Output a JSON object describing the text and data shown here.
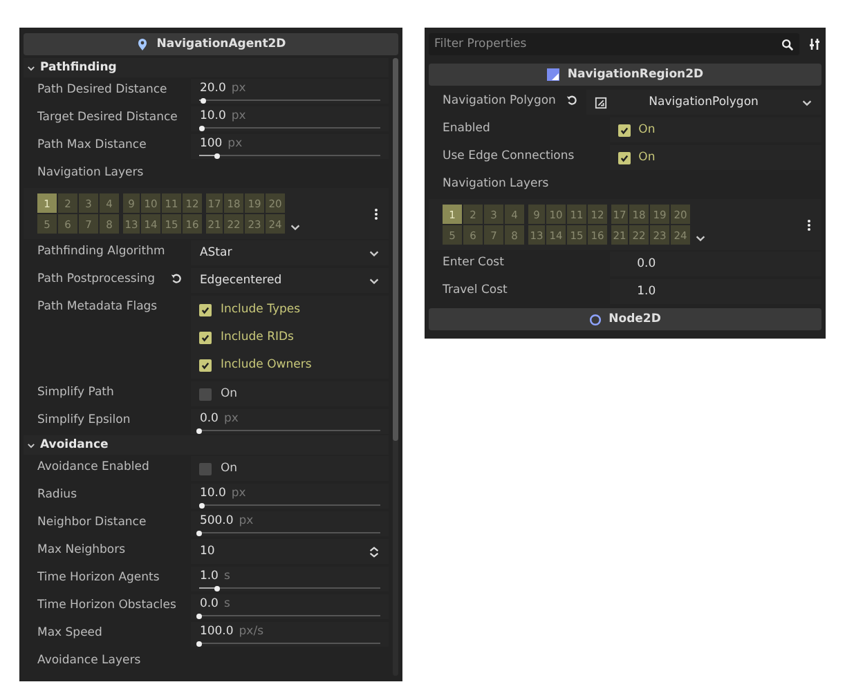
{
  "agent_panel": {
    "title": "NavigationAgent2D",
    "sections": [
      {
        "title": "Pathfinding",
        "expanded": true,
        "rows": [
          {
            "kind": "slider",
            "label": "Path Desired Distance",
            "value": "20.0",
            "unit": "px",
            "level": 0.02
          },
          {
            "kind": "slider",
            "label": "Target Desired Distance",
            "value": "10.0",
            "unit": "px",
            "level": 0.01
          },
          {
            "kind": "slider",
            "label": "Path Max Distance",
            "value": "100",
            "unit": "px",
            "level": 0.1
          },
          {
            "kind": "label",
            "label": "Navigation Layers"
          },
          {
            "kind": "layers",
            "layers": [
              {
                "label": "1",
                "selected": true
              },
              {
                "label": "2",
                "selected": false
              },
              {
                "label": "3",
                "selected": false
              },
              {
                "label": "4",
                "selected": false
              },
              {
                "label": "9",
                "selected": false
              },
              {
                "label": "10",
                "selected": false
              },
              {
                "label": "11",
                "selected": false
              },
              {
                "label": "12",
                "selected": false
              },
              {
                "label": "17",
                "selected": false
              },
              {
                "label": "18",
                "selected": false
              },
              {
                "label": "19",
                "selected": false
              },
              {
                "label": "20",
                "selected": false
              },
              {
                "label": "5",
                "selected": false
              },
              {
                "label": "6",
                "selected": false
              },
              {
                "label": "7",
                "selected": false
              },
              {
                "label": "8",
                "selected": false
              },
              {
                "label": "13",
                "selected": false
              },
              {
                "label": "14",
                "selected": false
              },
              {
                "label": "15",
                "selected": false
              },
              {
                "label": "16",
                "selected": false
              },
              {
                "label": "21",
                "selected": false
              },
              {
                "label": "22",
                "selected": false
              },
              {
                "label": "23",
                "selected": false
              },
              {
                "label": "24",
                "selected": false
              }
            ]
          },
          {
            "kind": "dropdown",
            "label": "Pathfinding Algorithm",
            "value": "AStar",
            "reset": false
          },
          {
            "kind": "dropdown",
            "label": "Path Postprocessing",
            "value": "Edgecentered",
            "reset": true
          },
          {
            "kind": "flags",
            "label": "Path Metadata Flags",
            "options": [
              {
                "label": "Include Types",
                "checked": true
              },
              {
                "label": "Include RIDs",
                "checked": true
              },
              {
                "label": "Include Owners",
                "checked": true
              }
            ]
          },
          {
            "kind": "checkbox",
            "label": "Simplify Path",
            "text": "On",
            "checked": false
          },
          {
            "kind": "slider",
            "label": "Simplify Epsilon",
            "value": "0.0",
            "unit": "px",
            "level": 0
          }
        ]
      },
      {
        "title": "Avoidance",
        "expanded": true,
        "rows": [
          {
            "kind": "checkbox",
            "label": "Avoidance Enabled",
            "text": "On",
            "checked": false
          },
          {
            "kind": "slider",
            "label": "Radius",
            "value": "10.0",
            "unit": "px",
            "level": 0.01
          },
          {
            "kind": "slider",
            "label": "Neighbor Distance",
            "value": "500.0",
            "unit": "px",
            "level": 0
          },
          {
            "kind": "spin",
            "label": "Max Neighbors",
            "value": "10"
          },
          {
            "kind": "slider",
            "label": "Time Horizon Agents",
            "value": "1.0",
            "unit": "s",
            "level": 0.1
          },
          {
            "kind": "slider",
            "label": "Time Horizon Obstacles",
            "value": "0.0",
            "unit": "s",
            "level": 0
          },
          {
            "kind": "slider",
            "label": "Max Speed",
            "value": "100.0",
            "unit": "px/s",
            "level": 0
          },
          {
            "kind": "label",
            "label": "Avoidance Layers"
          }
        ]
      }
    ]
  },
  "region_panel": {
    "filter": {
      "placeholder": "Filter Properties"
    },
    "title": "NavigationRegion2D",
    "rows": [
      {
        "kind": "resource",
        "label": "Navigation Polygon",
        "value": "NavigationPolygon",
        "reset": true
      },
      {
        "kind": "checkbox",
        "label": "Enabled",
        "text": "On",
        "checked": true
      },
      {
        "kind": "checkbox",
        "label": "Use Edge Connections",
        "text": "On",
        "checked": true
      },
      {
        "kind": "label",
        "label": "Navigation Layers"
      },
      {
        "kind": "layers",
        "layers": [
          {
            "label": "1",
            "selected": true
          },
          {
            "label": "2",
            "selected": false
          },
          {
            "label": "3",
            "selected": false
          },
          {
            "label": "4",
            "selected": false
          },
          {
            "label": "9",
            "selected": false
          },
          {
            "label": "10",
            "selected": false
          },
          {
            "label": "11",
            "selected": false
          },
          {
            "label": "12",
            "selected": false
          },
          {
            "label": "17",
            "selected": false
          },
          {
            "label": "18",
            "selected": false
          },
          {
            "label": "19",
            "selected": false
          },
          {
            "label": "20",
            "selected": false
          },
          {
            "label": "5",
            "selected": false
          },
          {
            "label": "6",
            "selected": false
          },
          {
            "label": "7",
            "selected": false
          },
          {
            "label": "8",
            "selected": false
          },
          {
            "label": "13",
            "selected": false
          },
          {
            "label": "14",
            "selected": false
          },
          {
            "label": "15",
            "selected": false
          },
          {
            "label": "16",
            "selected": false
          },
          {
            "label": "21",
            "selected": false
          },
          {
            "label": "22",
            "selected": false
          },
          {
            "label": "23",
            "selected": false
          },
          {
            "label": "24",
            "selected": false
          }
        ]
      },
      {
        "kind": "number",
        "label": "Enter Cost",
        "value": "0.0"
      },
      {
        "kind": "number",
        "label": "Travel Cost",
        "value": "1.0"
      }
    ],
    "footer_title": "Node2D"
  }
}
